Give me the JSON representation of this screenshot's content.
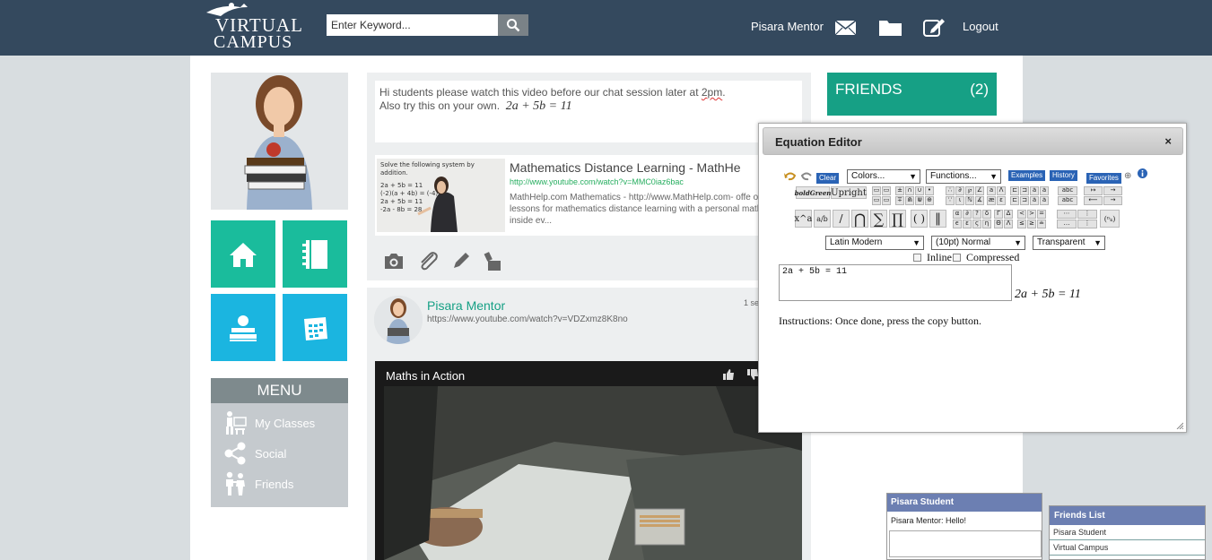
{
  "header": {
    "logo_line1": "VIRTUAL",
    "logo_line2": "CAMPUS",
    "search_placeholder": "Enter Keyword...",
    "username": "Pisara Mentor",
    "logout": "Logout",
    "icons": [
      "envelope-icon",
      "folder-icon",
      "edit-icon"
    ]
  },
  "sidebar": {
    "tiles": [
      {
        "icon": "home-icon",
        "color": "#1abc9c"
      },
      {
        "icon": "notebook-icon",
        "color": "#1abc9c"
      },
      {
        "icon": "apple-books-icon",
        "color": "#1bb5e0"
      },
      {
        "icon": "calendar-icon",
        "color": "#1bb5e0"
      }
    ],
    "menu_title": "MENU",
    "menu_items": [
      {
        "label": "My Classes",
        "icon": "classroom-icon"
      },
      {
        "label": "Social",
        "icon": "share-icon"
      },
      {
        "label": "Friends",
        "icon": "people-icon"
      }
    ]
  },
  "post1": {
    "line1_prefix": "Hi students please watch this video before our chat session later at ",
    "line1_time": "2pm",
    "line1_suffix": ".",
    "line2": "Also try this on your own.",
    "equation": "2a + 5b = 11",
    "link_title": "Mathematics Distance Learning - MathHe",
    "link_url": "http://www.youtube.com/watch?v=MMC0iaz6bac",
    "link_desc": "MathHelp.com Mathematics - http://www.MathHelp.com- offe online math lessons for mathematics distance learning with a personal math teacher inside ev...",
    "thumb_text1": "Solve the following system by",
    "thumb_text2": "addition.",
    "thumb_eq1": "2a + 5b = 11",
    "thumb_eq2": "(-2)(a + 4b) = (-4)",
    "thumb_eq3": "2a + 5b = 11",
    "thumb_eq4": "-2a - 8b = 28",
    "tools": [
      "camera-icon",
      "paperclip-icon",
      "pencil-icon",
      "stamp-icon"
    ]
  },
  "post2": {
    "author": "Pisara Mentor",
    "url": "https://www.youtube.com/watch?v=VDZxmz8K8no",
    "time": "1 se",
    "video_title": "Maths in Action"
  },
  "friends": {
    "title": "FRIENDS",
    "count": "(2)"
  },
  "equation_editor": {
    "title": "Equation Editor",
    "close": "×",
    "clear": "Clear",
    "colors": "Colors...",
    "functions": "Functions...",
    "examples": "Examples",
    "history": "History",
    "favorites": "Favorites",
    "bold_green": "boldGreen",
    "upright": "Upright",
    "font": "Latin Modern",
    "size": "(10pt) Normal",
    "background": "Transparent",
    "inline": "Inline",
    "compressed": "Compressed",
    "input_value": "2a + 5b = 11",
    "preview": "2a + 5b = 11",
    "instructions": "Instructions: Once done, press the copy button.",
    "palette_big": [
      "x^a",
      "a/b",
      "/",
      "⋂",
      "∑",
      "∏",
      "( )",
      "‖"
    ]
  },
  "chat": {
    "title": "Pisara Student",
    "message": "Pisara Mentor: Hello!"
  },
  "friends_list": {
    "title": "Friends List",
    "items": [
      "Pisara Student",
      "Virtual Campus"
    ]
  }
}
